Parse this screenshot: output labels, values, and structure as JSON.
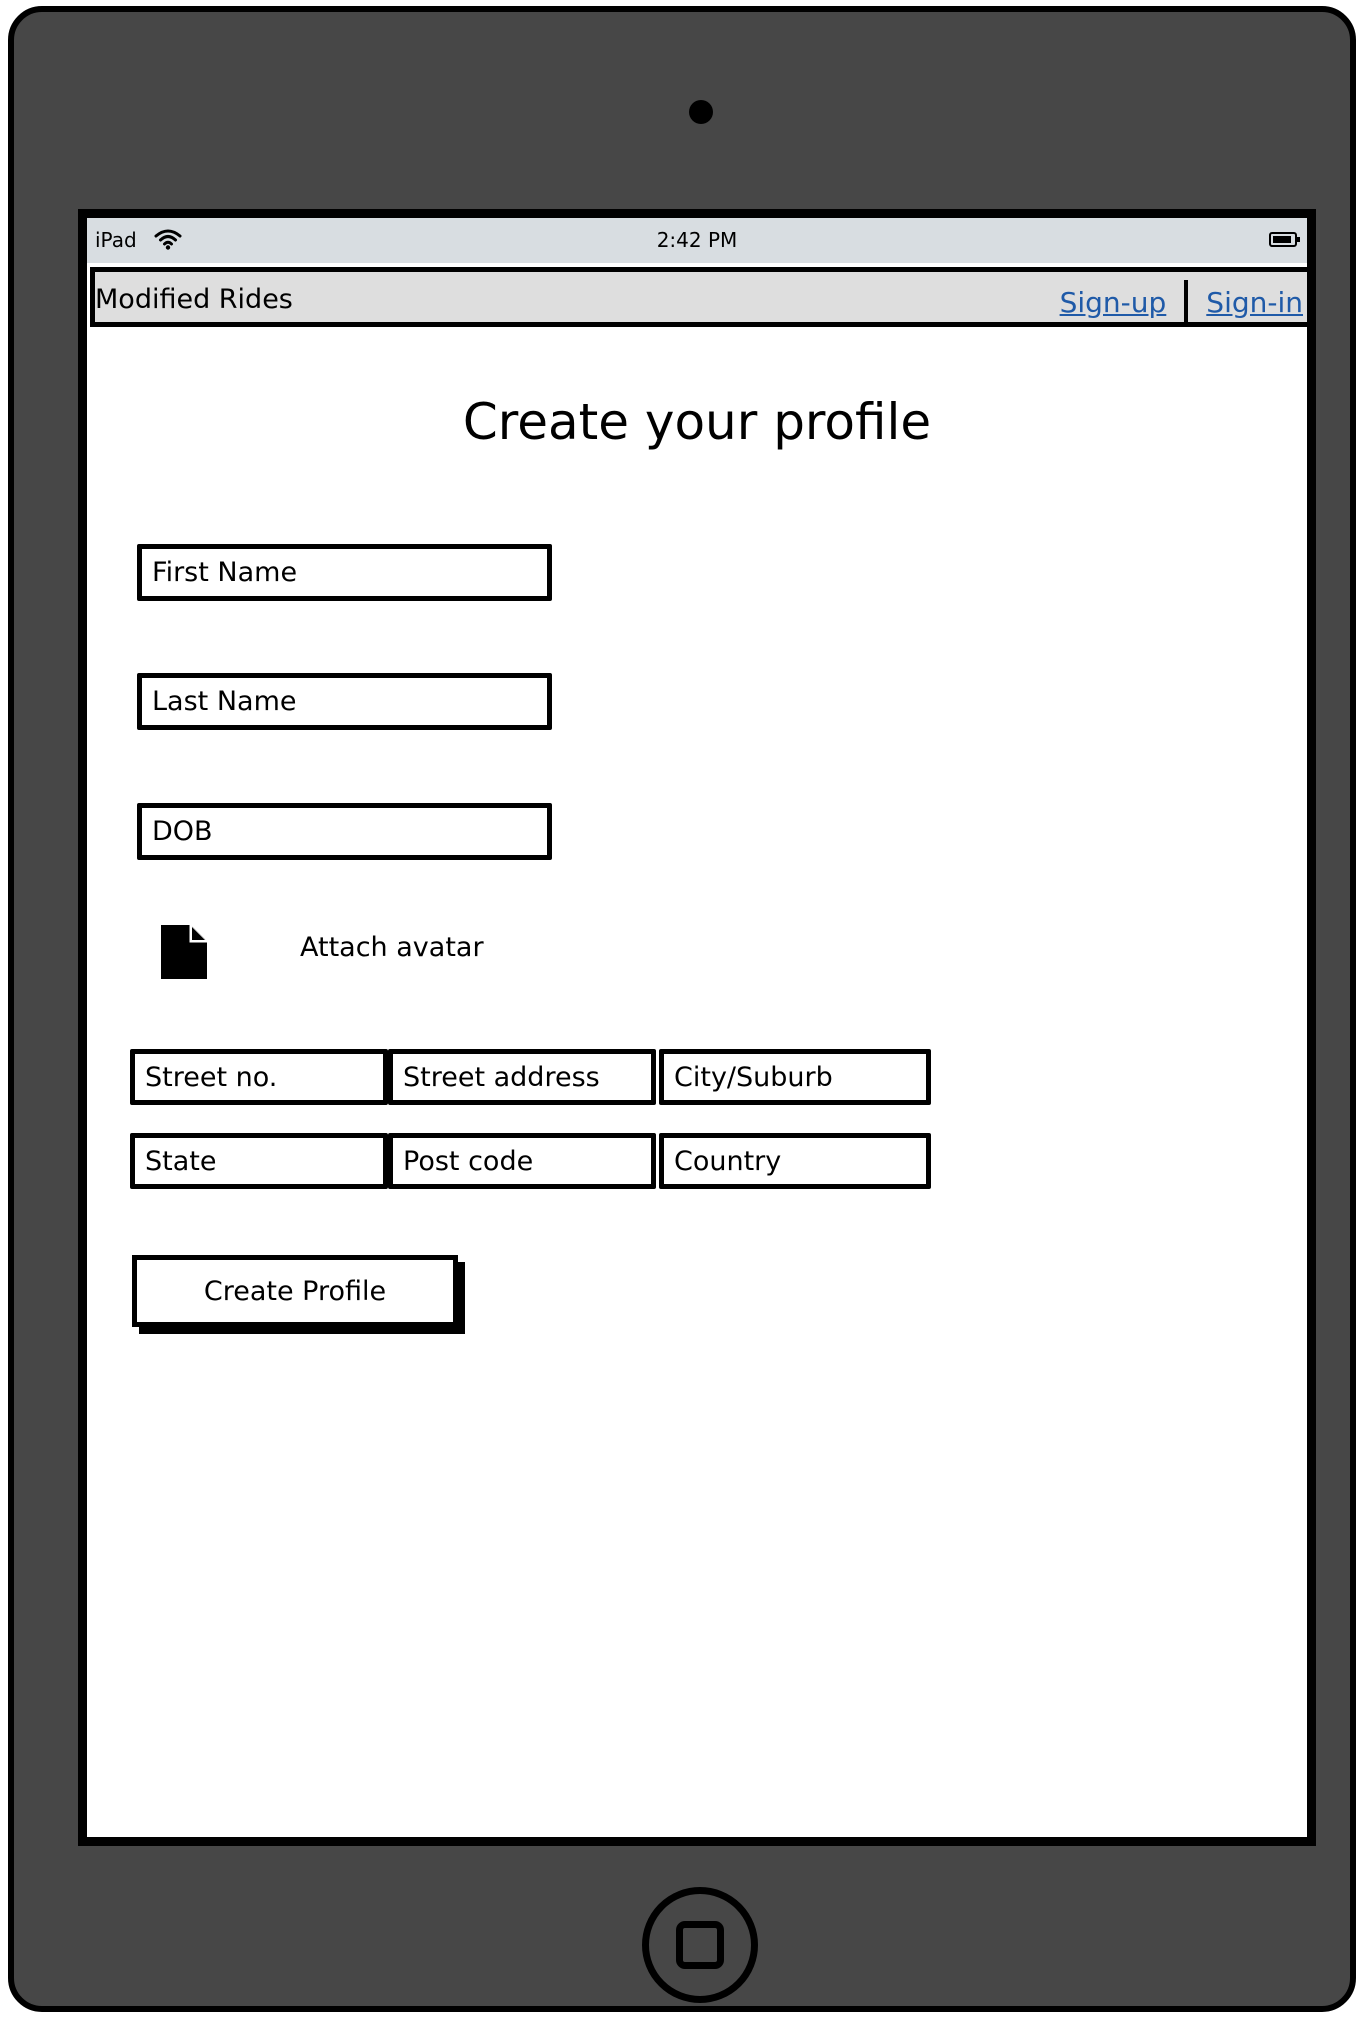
{
  "device": {
    "model": "iPad"
  },
  "statusbar": {
    "carrier": "iPad",
    "time": "2:42 PM"
  },
  "navbar": {
    "title": "Modified Rides",
    "signup_label": "Sign-up",
    "signin_label": "Sign-in"
  },
  "page": {
    "title": "Create your profile"
  },
  "form": {
    "first_name_placeholder": "First Name",
    "last_name_placeholder": "Last Name",
    "dob_placeholder": "DOB",
    "attach_label": "Attach avatar",
    "street_no_placeholder": "Street no.",
    "street_address_placeholder": "Street address",
    "city_placeholder": "City/Suburb",
    "state_placeholder": "State",
    "post_code_placeholder": "Post code",
    "country_placeholder": "Country",
    "submit_label": "Create Profile"
  },
  "icons": {
    "attach": "file-icon",
    "wifi": "wifi-icon",
    "battery": "battery-icon"
  }
}
